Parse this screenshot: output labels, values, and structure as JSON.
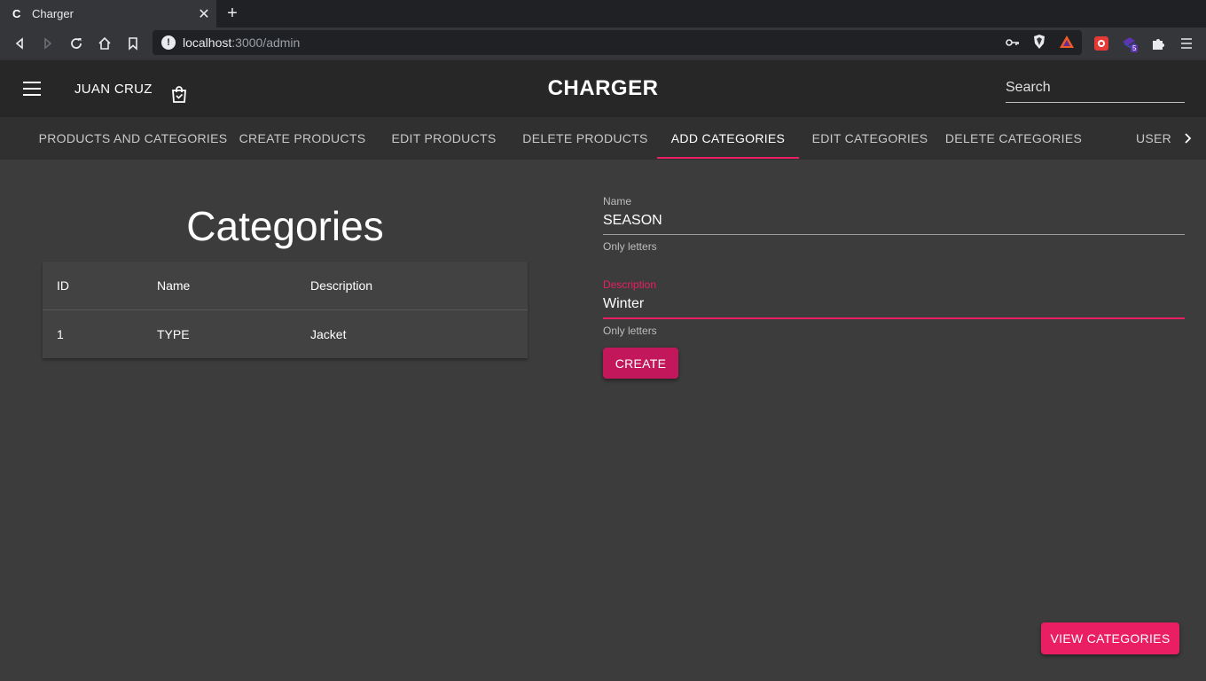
{
  "browser": {
    "tab_favicon": "C",
    "tab_title": "Charger",
    "url_host": "localhost",
    "url_rest": ":3000/admin",
    "ext_badge": "5"
  },
  "header": {
    "user": "JUAN CRUZ",
    "brand": "CHARGER",
    "search_placeholder": "Search"
  },
  "tabs": [
    {
      "label": "PRODUCTS AND CATEGORIES"
    },
    {
      "label": "CREATE PRODUCTS"
    },
    {
      "label": "EDIT PRODUCTS"
    },
    {
      "label": "DELETE PRODUCTS"
    },
    {
      "label": "ADD CATEGORIES",
      "active": true
    },
    {
      "label": "EDIT CATEGORIES"
    },
    {
      "label": "DELETE CATEGORIES"
    },
    {
      "label": "USER"
    }
  ],
  "categories": {
    "title": "Categories",
    "columns": [
      "ID",
      "Name",
      "Description"
    ],
    "rows": [
      {
        "id": "1",
        "name": "TYPE",
        "description": "Jacket"
      }
    ]
  },
  "form": {
    "name": {
      "label": "Name",
      "value": "SEASON",
      "helper": "Only letters"
    },
    "description": {
      "label": "Description",
      "value": "Winter",
      "helper": "Only letters"
    },
    "create_label": "CREATE"
  },
  "view_categories_label": "VIEW CATEGORIES",
  "colors": {
    "accent": "#e91e63",
    "button": "#c2185b",
    "background": "#3c3c3c"
  }
}
